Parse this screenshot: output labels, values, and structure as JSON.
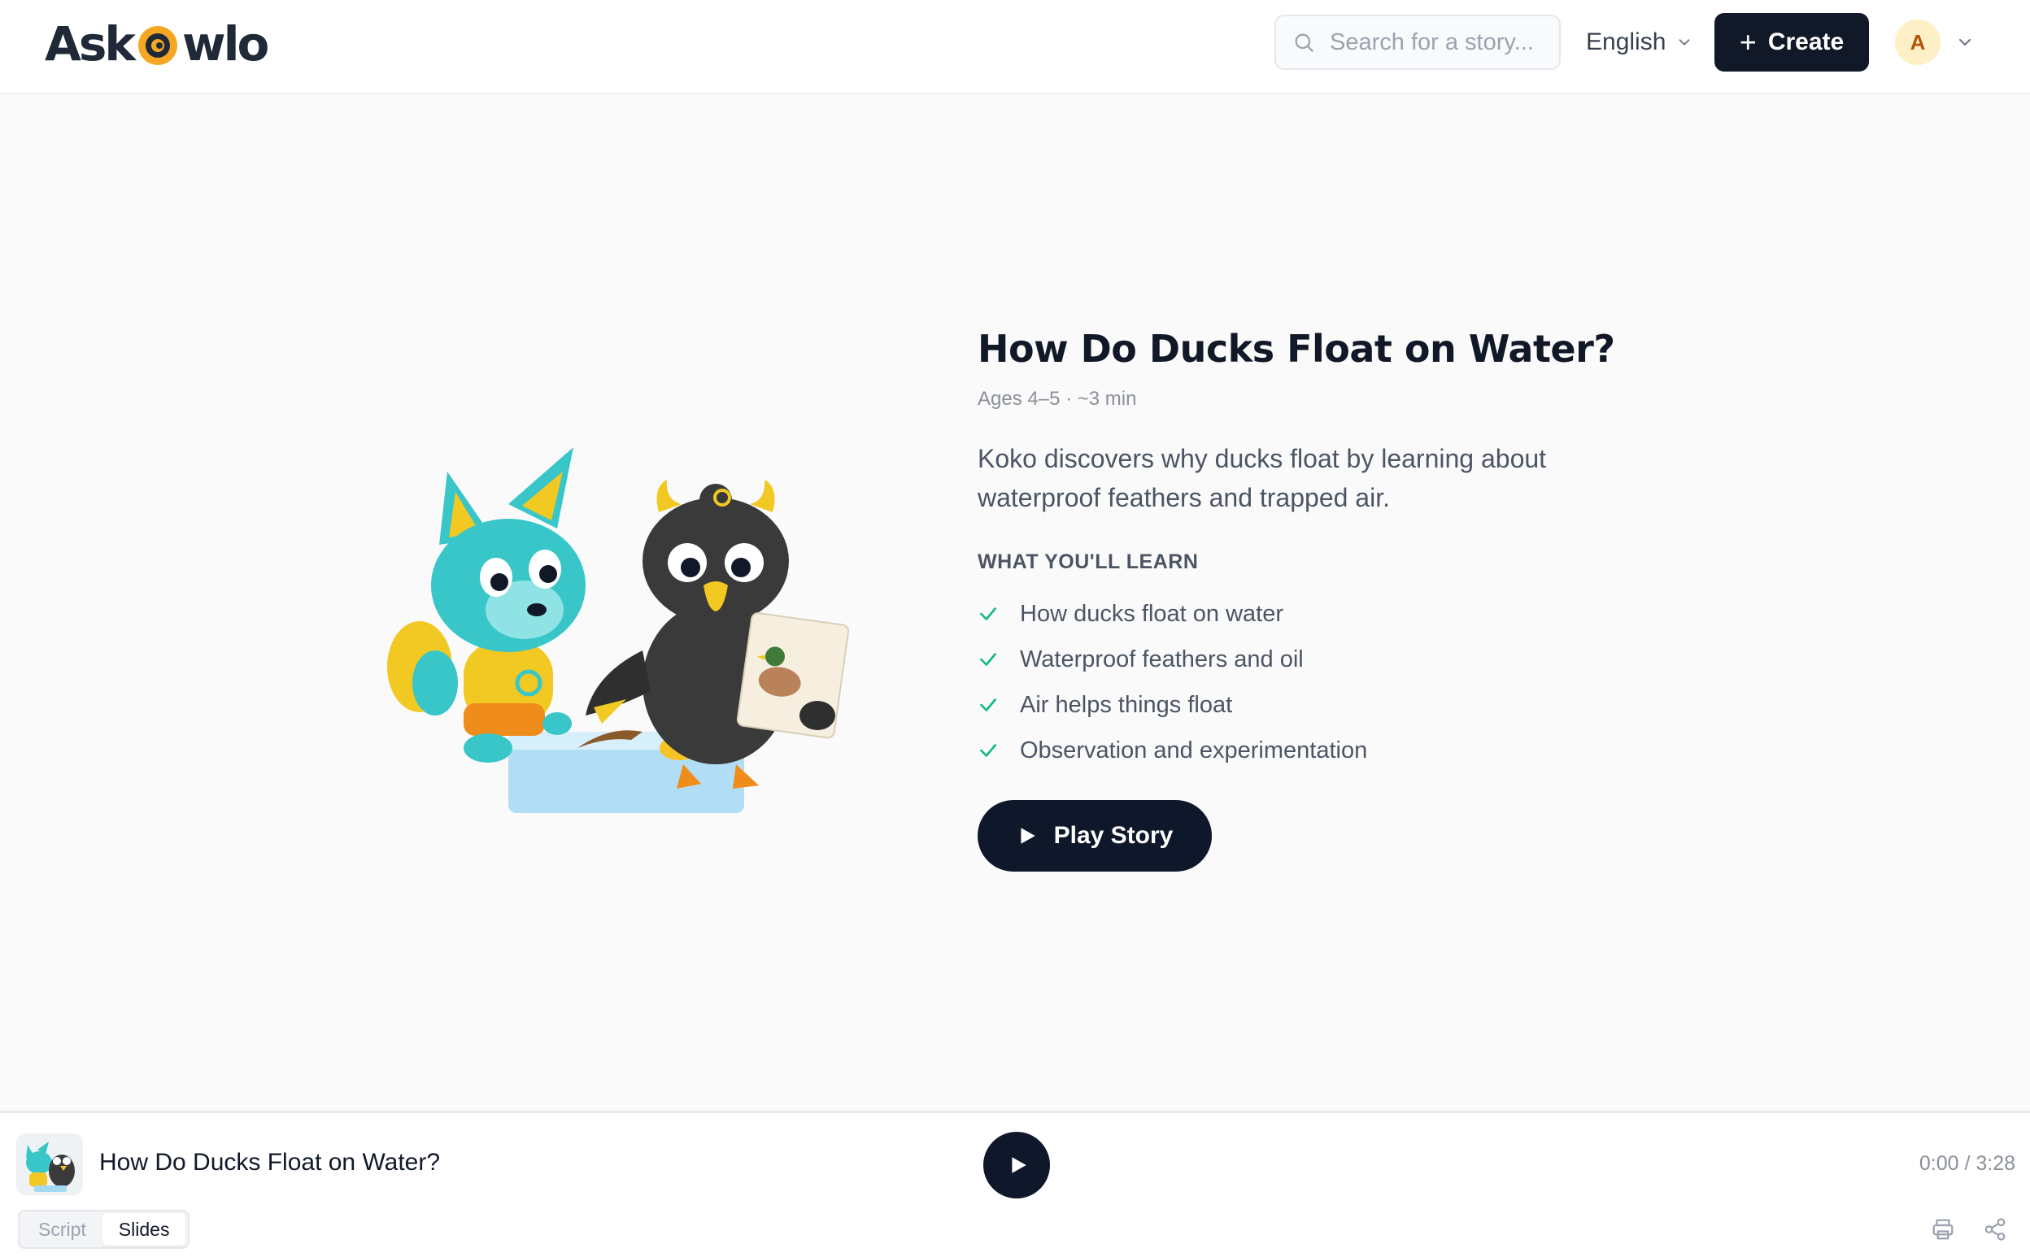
{
  "header": {
    "logo_left": "Ask",
    "logo_right": "wlo",
    "search_placeholder": "Search for a story...",
    "language": "English",
    "create_label": "Create",
    "avatar_initial": "A"
  },
  "story": {
    "title": "How Do Ducks Float on Water?",
    "meta": "Ages 4–5 · ~3 min",
    "description": "Koko discovers why ducks float by learning about waterproof feathers and trapped air.",
    "learn_heading": "WHAT YOU'LL LEARN",
    "learn_items": [
      "How ducks float on water",
      "Waterproof feathers and oil",
      "Air helps things float",
      "Observation and experimentation"
    ],
    "play_label": "Play Story"
  },
  "player": {
    "title": "How Do Ducks Float on Water?",
    "time": "0:00 / 3:28",
    "tabs": [
      "Script",
      "Slides"
    ],
    "active_tab": "Slides"
  },
  "colors": {
    "primary": "#111827",
    "check": "#10b981",
    "logo_accent": "#f5a623",
    "avatar_bg": "#fdf0c6"
  },
  "icons": {
    "search": "search-icon",
    "language": "chevron-down-icon",
    "create": "plus-icon",
    "check": "check-icon",
    "play": "play-icon",
    "print": "printer-icon",
    "share": "share-icon"
  }
}
